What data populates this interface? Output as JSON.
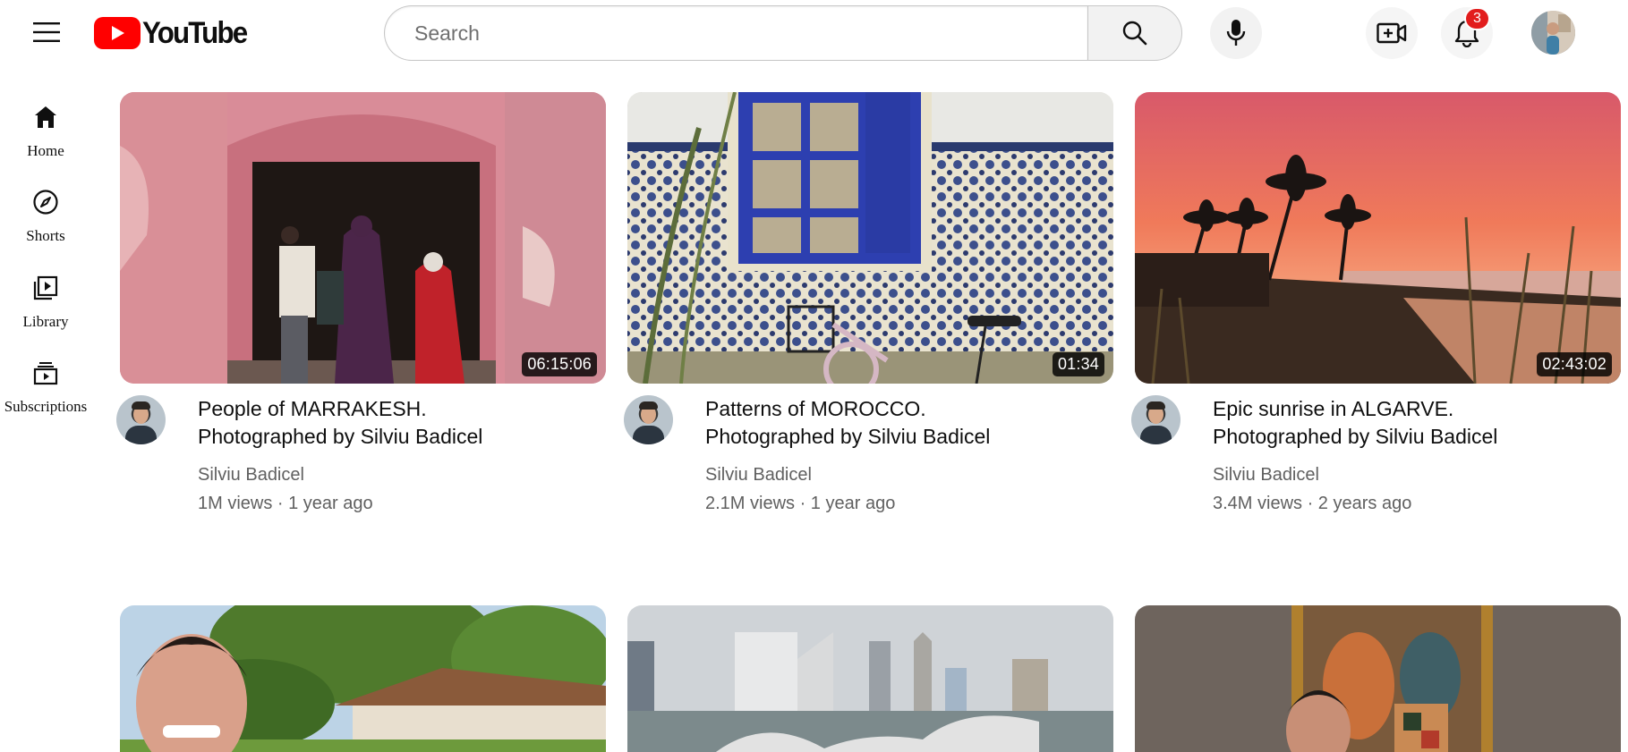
{
  "header": {
    "logo_text": "YouTube",
    "search_placeholder": "Search",
    "notification_count": "3"
  },
  "sidebar": {
    "items": [
      {
        "label": "Home",
        "icon": "home-icon"
      },
      {
        "label": "Shorts",
        "icon": "compass-icon"
      },
      {
        "label": "Library",
        "icon": "library-icon"
      },
      {
        "label": "Subscriptions",
        "icon": "subscriptions-icon"
      }
    ]
  },
  "videos": [
    {
      "title_line1": "People of MARRAKESH.",
      "title_line2": "Photographed by Silviu Badicel",
      "channel": "Silviu Badicel",
      "meta": "1M views · 1 year ago",
      "duration": "06:15:06"
    },
    {
      "title_line1": "Patterns of MOROCCO.",
      "title_line2": "Photographed by Silviu Badicel",
      "channel": "Silviu Badicel",
      "meta": "2.1M views · 1 year ago",
      "duration": "01:34"
    },
    {
      "title_line1": "Epic sunrise in ALGARVE.",
      "title_line2": "Photographed by Silviu Badicel",
      "channel": "Silviu Badicel",
      "meta": "3.4M views · 2 years ago",
      "duration": "02:43:02"
    }
  ],
  "colors": {
    "brand_red": "#ff0000",
    "badge_red": "#e21d1d",
    "text_primary": "#0f0f0f",
    "text_secondary": "#606060"
  }
}
